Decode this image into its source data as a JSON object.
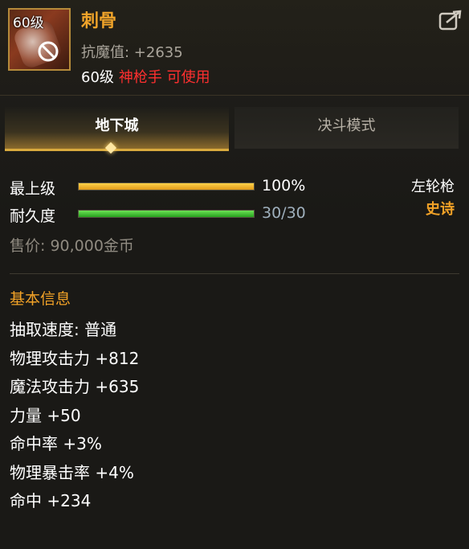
{
  "header": {
    "level_badge": "60级",
    "item_name": "刺骨",
    "stat_line": "抗魔值: +2635",
    "req_level": "60级",
    "req_class": "神枪手 可使用"
  },
  "tabs": [
    {
      "label": "地下城",
      "active": true
    },
    {
      "label": "决斗模式",
      "active": false
    }
  ],
  "bars": {
    "grade_label": "最上级",
    "grade_value": "100%",
    "grade_fraction": 1.0,
    "durability_label": "耐久度",
    "durability_value": "30/30",
    "durability_fraction": 1.0
  },
  "weapon_type": "左轮枪",
  "rarity": "史诗",
  "price": "售价: 90,000金币",
  "info": {
    "title": "基本信息",
    "lines": [
      "抽取速度: 普通",
      "物理攻击力 +812",
      "魔法攻击力 +635",
      "力量 +50",
      "命中率 +3%",
      "物理暴击率 +4%",
      "命中 +234"
    ]
  },
  "colors": {
    "accent_gold": "#f2a227",
    "requirement_red": "#ff2f2f",
    "durability_green": "#3cc22b",
    "grade_bar": "#f0b52f"
  },
  "icons": {
    "share": "share-export-icon",
    "forbidden": "ban-icon"
  }
}
